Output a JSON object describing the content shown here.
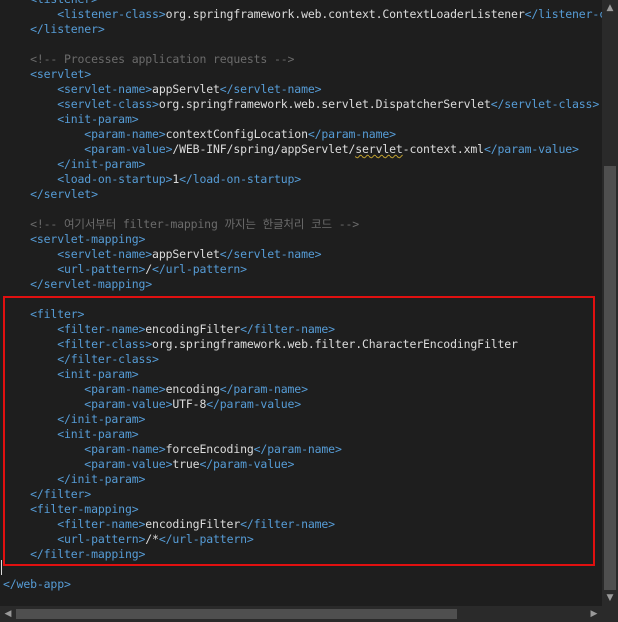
{
  "editor": {
    "lines": [
      [
        {
          "t": "    ",
          "c": "txt"
        },
        {
          "t": "<listener>",
          "c": "tag"
        }
      ],
      [
        {
          "t": "        ",
          "c": "txt"
        },
        {
          "t": "<listener-class>",
          "c": "tag"
        },
        {
          "t": "org.springframework.web.context.ContextLoaderListener",
          "c": "txt"
        },
        {
          "t": "</listener-class>",
          "c": "tag"
        }
      ],
      [
        {
          "t": "    ",
          "c": "txt"
        },
        {
          "t": "</listener>",
          "c": "tag"
        }
      ],
      [],
      [
        {
          "t": "    ",
          "c": "txt"
        },
        {
          "t": "<!-- Processes application requests -->",
          "c": "comment"
        }
      ],
      [
        {
          "t": "    ",
          "c": "txt"
        },
        {
          "t": "<servlet>",
          "c": "tag"
        }
      ],
      [
        {
          "t": "        ",
          "c": "txt"
        },
        {
          "t": "<servlet-name>",
          "c": "tag"
        },
        {
          "t": "appServlet",
          "c": "txt"
        },
        {
          "t": "</servlet-name>",
          "c": "tag"
        }
      ],
      [
        {
          "t": "        ",
          "c": "txt"
        },
        {
          "t": "<servlet-class>",
          "c": "tag"
        },
        {
          "t": "org.springframework.web.servlet.DispatcherServlet",
          "c": "txt"
        },
        {
          "t": "</servlet-class>",
          "c": "tag"
        }
      ],
      [
        {
          "t": "        ",
          "c": "txt"
        },
        {
          "t": "<init-param>",
          "c": "tag"
        }
      ],
      [
        {
          "t": "            ",
          "c": "txt"
        },
        {
          "t": "<param-name>",
          "c": "tag"
        },
        {
          "t": "contextConfigLocation",
          "c": "txt"
        },
        {
          "t": "</param-name>",
          "c": "tag"
        }
      ],
      [
        {
          "t": "            ",
          "c": "txt"
        },
        {
          "t": "<param-value>",
          "c": "tag"
        },
        {
          "t": "/WEB-INF/spring/appServlet/",
          "c": "txt"
        },
        {
          "t": "servlet",
          "c": "txt squiggle"
        },
        {
          "t": "-context.xml",
          "c": "txt"
        },
        {
          "t": "</param-value>",
          "c": "tag"
        }
      ],
      [
        {
          "t": "        ",
          "c": "txt"
        },
        {
          "t": "</init-param>",
          "c": "tag"
        }
      ],
      [
        {
          "t": "        ",
          "c": "txt"
        },
        {
          "t": "<load-on-startup>",
          "c": "tag"
        },
        {
          "t": "1",
          "c": "txt"
        },
        {
          "t": "</load-on-startup>",
          "c": "tag"
        }
      ],
      [
        {
          "t": "    ",
          "c": "txt"
        },
        {
          "t": "</servlet>",
          "c": "tag"
        }
      ],
      [],
      [
        {
          "t": "    ",
          "c": "txt"
        },
        {
          "t": "<!-- 여기서부터 filter-mapping 까지는 한글처리 코드 -->",
          "c": "comment"
        }
      ],
      [
        {
          "t": "    ",
          "c": "txt"
        },
        {
          "t": "<servlet-mapping>",
          "c": "tag"
        }
      ],
      [
        {
          "t": "        ",
          "c": "txt"
        },
        {
          "t": "<servlet-name>",
          "c": "tag"
        },
        {
          "t": "appServlet",
          "c": "txt"
        },
        {
          "t": "</servlet-name>",
          "c": "tag"
        }
      ],
      [
        {
          "t": "        ",
          "c": "txt"
        },
        {
          "t": "<url-pattern>",
          "c": "tag"
        },
        {
          "t": "/",
          "c": "txt"
        },
        {
          "t": "</url-pattern>",
          "c": "tag"
        }
      ],
      [
        {
          "t": "    ",
          "c": "txt"
        },
        {
          "t": "</servlet-mapping>",
          "c": "tag"
        }
      ],
      [],
      [
        {
          "t": "    ",
          "c": "txt"
        },
        {
          "t": "<filter>",
          "c": "tag"
        }
      ],
      [
        {
          "t": "        ",
          "c": "txt"
        },
        {
          "t": "<filter-name>",
          "c": "tag"
        },
        {
          "t": "encodingFilter",
          "c": "txt"
        },
        {
          "t": "</filter-name>",
          "c": "tag"
        }
      ],
      [
        {
          "t": "        ",
          "c": "txt"
        },
        {
          "t": "<filter-class>",
          "c": "tag"
        },
        {
          "t": "org.springframework.web.filter.CharacterEncodingFilter",
          "c": "txt"
        }
      ],
      [
        {
          "t": "        ",
          "c": "txt"
        },
        {
          "t": "</filter-class>",
          "c": "tag"
        }
      ],
      [
        {
          "t": "        ",
          "c": "txt"
        },
        {
          "t": "<init-param>",
          "c": "tag"
        }
      ],
      [
        {
          "t": "            ",
          "c": "txt"
        },
        {
          "t": "<param-name>",
          "c": "tag"
        },
        {
          "t": "encoding",
          "c": "txt"
        },
        {
          "t": "</param-name>",
          "c": "tag"
        }
      ],
      [
        {
          "t": "            ",
          "c": "txt"
        },
        {
          "t": "<param-value>",
          "c": "tag"
        },
        {
          "t": "UTF-8",
          "c": "txt"
        },
        {
          "t": "</param-value>",
          "c": "tag"
        }
      ],
      [
        {
          "t": "        ",
          "c": "txt"
        },
        {
          "t": "</init-param>",
          "c": "tag"
        }
      ],
      [
        {
          "t": "        ",
          "c": "txt"
        },
        {
          "t": "<init-param>",
          "c": "tag"
        }
      ],
      [
        {
          "t": "            ",
          "c": "txt"
        },
        {
          "t": "<param-name>",
          "c": "tag"
        },
        {
          "t": "forceEncoding",
          "c": "txt"
        },
        {
          "t": "</param-name>",
          "c": "tag"
        }
      ],
      [
        {
          "t": "            ",
          "c": "txt"
        },
        {
          "t": "<param-value>",
          "c": "tag"
        },
        {
          "t": "true",
          "c": "txt"
        },
        {
          "t": "</param-value>",
          "c": "tag"
        }
      ],
      [
        {
          "t": "        ",
          "c": "txt"
        },
        {
          "t": "</init-param>",
          "c": "tag"
        }
      ],
      [
        {
          "t": "    ",
          "c": "txt"
        },
        {
          "t": "</filter>",
          "c": "tag"
        }
      ],
      [
        {
          "t": "    ",
          "c": "txt"
        },
        {
          "t": "<filter-mapping>",
          "c": "tag"
        }
      ],
      [
        {
          "t": "        ",
          "c": "txt"
        },
        {
          "t": "<filter-name>",
          "c": "tag"
        },
        {
          "t": "encodingFilter",
          "c": "txt"
        },
        {
          "t": "</filter-name>",
          "c": "tag"
        }
      ],
      [
        {
          "t": "        ",
          "c": "txt"
        },
        {
          "t": "<url-pattern>",
          "c": "tag"
        },
        {
          "t": "/*",
          "c": "txt"
        },
        {
          "t": "</url-pattern>",
          "c": "tag"
        }
      ],
      [
        {
          "t": "    ",
          "c": "txt"
        },
        {
          "t": "</filter-mapping>",
          "c": "tag"
        }
      ],
      [],
      [
        {
          "t": "</web-app>",
          "c": "tag"
        }
      ]
    ]
  },
  "scrollbars": {
    "up_arrow": "▲",
    "down_arrow": "▼",
    "left_arrow": "◀",
    "right_arrow": "▶"
  },
  "colors": {
    "background": "#1e1e1e",
    "tag": "#569cd6",
    "text": "#dcdcdc",
    "comment": "#6b6b6b",
    "highlight_border": "#e01010"
  }
}
